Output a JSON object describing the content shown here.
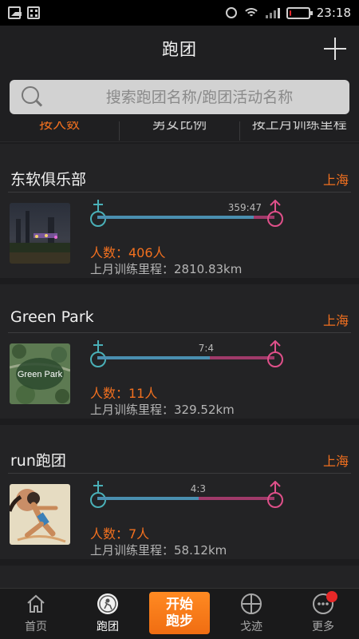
{
  "status_bar": {
    "time": "23:18",
    "battery_level": 0.1,
    "battery_color": "#e5262b"
  },
  "header": {
    "title": "跑团",
    "add_icon": "plus-icon"
  },
  "search": {
    "placeholder": "搜索跑团名称/跑团活动名称"
  },
  "sort_tabs": [
    {
      "label": "按人数",
      "active": true
    },
    {
      "label": "男女比例",
      "active": false
    },
    {
      "label": "按上月训练里程",
      "active": false
    }
  ],
  "clubs": [
    {
      "name": "东软俱乐部",
      "city": "上海",
      "ratio": "359:47",
      "male_fraction": 0.884,
      "members": "人数：406人",
      "distance": "上月训练里程：2810.83km",
      "thumb_icon": "city-night-photo"
    },
    {
      "name": "Green Park",
      "city": "上海",
      "ratio": "7:4",
      "male_fraction": 0.636,
      "members": "人数：11人",
      "distance": "上月训练里程：329.52km",
      "thumb_text": "Green Park",
      "thumb_icon": "park-aerial-photo"
    },
    {
      "name": "run跑团",
      "city": "上海",
      "ratio": "4:3",
      "male_fraction": 0.571,
      "members": "人数：7人",
      "distance": "上月训练里程：58.12km",
      "thumb_icon": "runner-illustration"
    }
  ],
  "tabbar": {
    "home": "首页",
    "club": "跑团",
    "start": "开始跑步",
    "track": "戈迹",
    "more": "更多"
  },
  "colors": {
    "accent": "#f2701f",
    "male": "#4a8fb0",
    "female": "#a03a6a",
    "badge": "#e82828"
  }
}
